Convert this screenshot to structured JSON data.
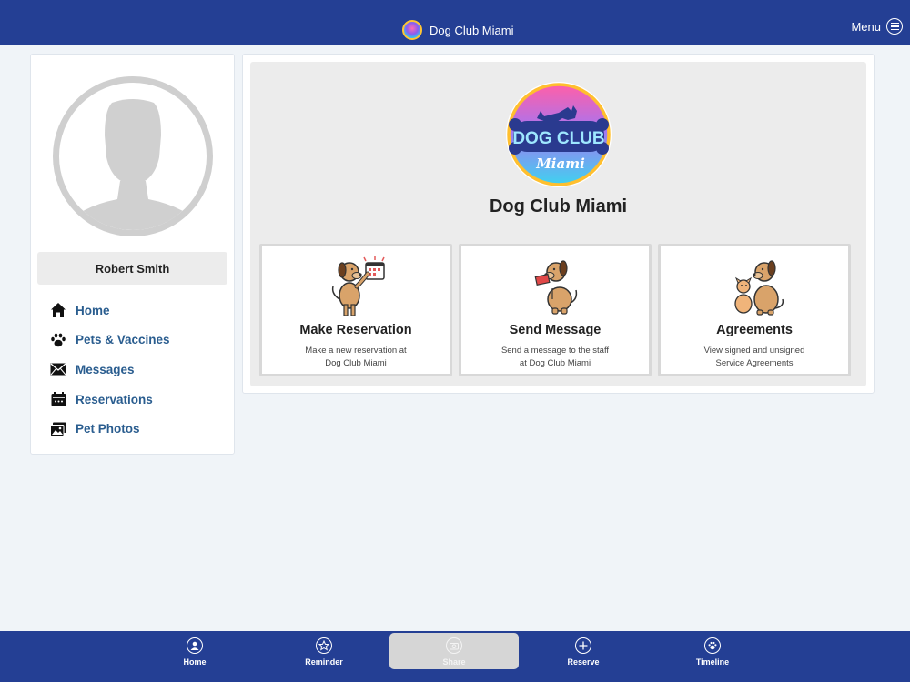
{
  "header": {
    "title": "Dog Club Miami",
    "menu_label": "Menu",
    "logo_icon": "dog-club-logo-icon",
    "menu_icon": "hamburger-menu-icon"
  },
  "profile": {
    "name": "Robert Smith",
    "avatar_icon": "default-avatar-icon"
  },
  "sidebar": {
    "items": [
      {
        "label": "Home",
        "icon": "house-icon"
      },
      {
        "label": "Pets & Vaccines",
        "icon": "paw-icon"
      },
      {
        "label": "Messages",
        "icon": "envelope-icon"
      },
      {
        "label": "Reservations",
        "icon": "calendar-icon"
      },
      {
        "label": "Pet Photos",
        "icon": "photos-icon"
      }
    ]
  },
  "main": {
    "logo_text_top": "DOG CLUB",
    "logo_text_bottom": "Miami",
    "title": "Dog Club Miami",
    "cards": [
      {
        "title": "Make Reservation",
        "description": "Make a new reservation at\nDog Club Miami",
        "icon": "dog-calendar-icon"
      },
      {
        "title": "Send Message",
        "description": "Send a message to the staff\nat Dog Club Miami",
        "icon": "dog-letter-icon"
      },
      {
        "title": "Agreements",
        "description": "View signed and unsigned\nService Agreements",
        "icon": "dog-and-puppy-icon"
      }
    ]
  },
  "bottom_nav": {
    "tabs": [
      {
        "label": "Home",
        "icon": "home-circle-icon",
        "active": false
      },
      {
        "label": "Reminder",
        "icon": "star-circle-icon",
        "active": false
      },
      {
        "label": "Share",
        "icon": "camera-circle-icon",
        "active": true
      },
      {
        "label": "Reserve",
        "icon": "plus-circle-icon",
        "active": false
      },
      {
        "label": "Timeline",
        "icon": "paw-circle-icon",
        "active": false
      }
    ]
  },
  "colors": {
    "brand_blue": "#243f94",
    "link_blue": "#2a5d8f",
    "page_bg": "#f0f4f8"
  }
}
